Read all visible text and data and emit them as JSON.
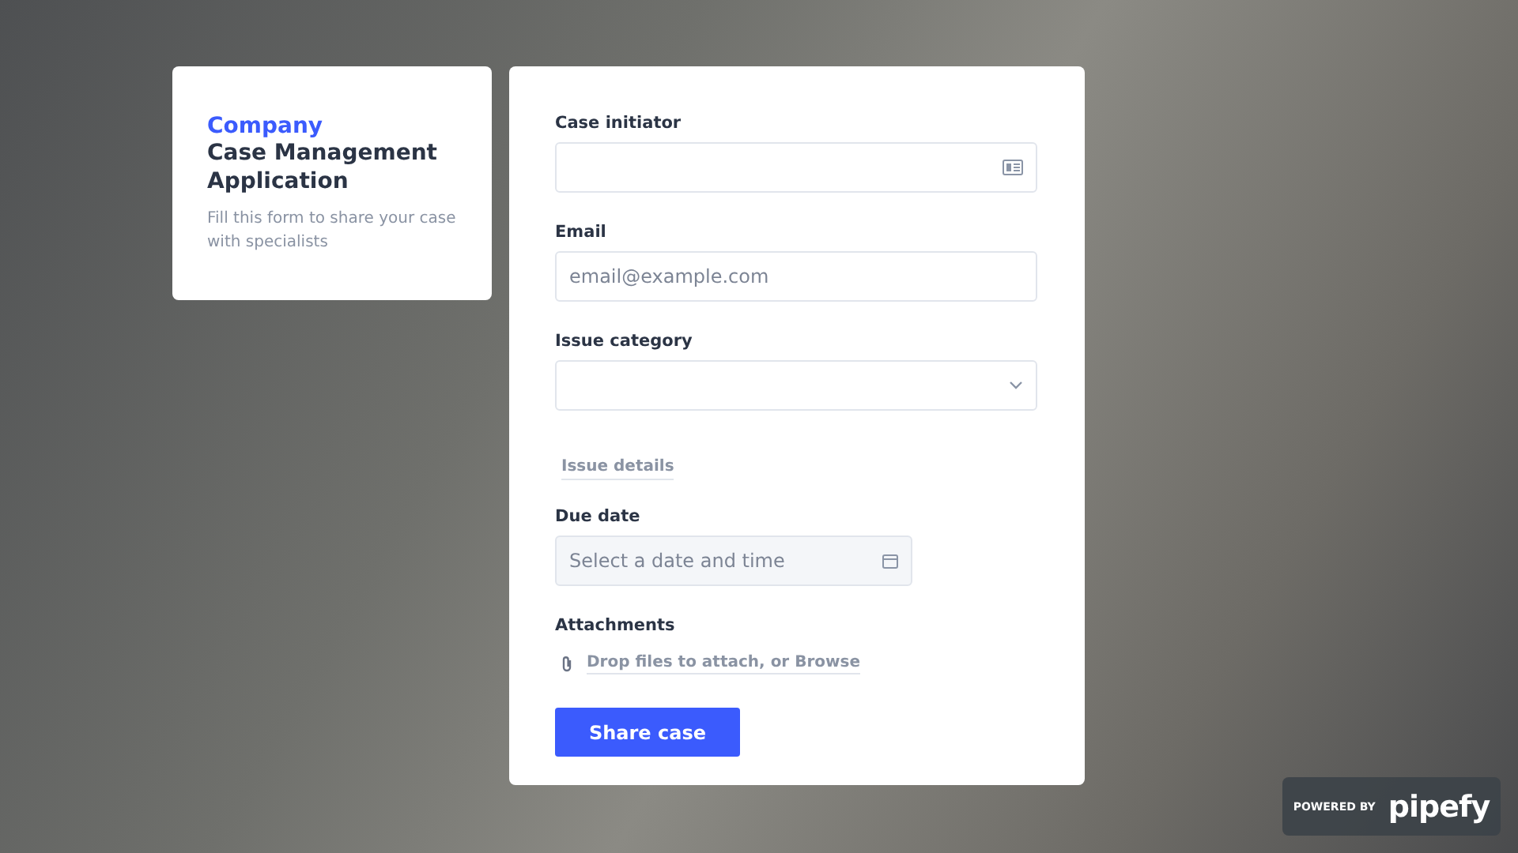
{
  "intro": {
    "company": "Company",
    "title": "Case Management Application",
    "description": "Fill this form to share your case with specialists"
  },
  "form": {
    "fields": [
      {
        "kind": "contact",
        "label": "Case initiator"
      },
      {
        "kind": "email",
        "label": "Email",
        "placeholder": "email@example.com"
      },
      {
        "kind": "select",
        "label": "Issue category"
      },
      {
        "kind": "details",
        "link": "Issue details"
      },
      {
        "kind": "date",
        "label": "Due date",
        "placeholder": "Select a date and time"
      },
      {
        "kind": "attachment",
        "label": "Attachments",
        "link": "Drop files to attach, or Browse"
      }
    ],
    "submit": "Share case"
  },
  "badge": {
    "prefix": "POWERED BY",
    "brand": "pipefy"
  }
}
